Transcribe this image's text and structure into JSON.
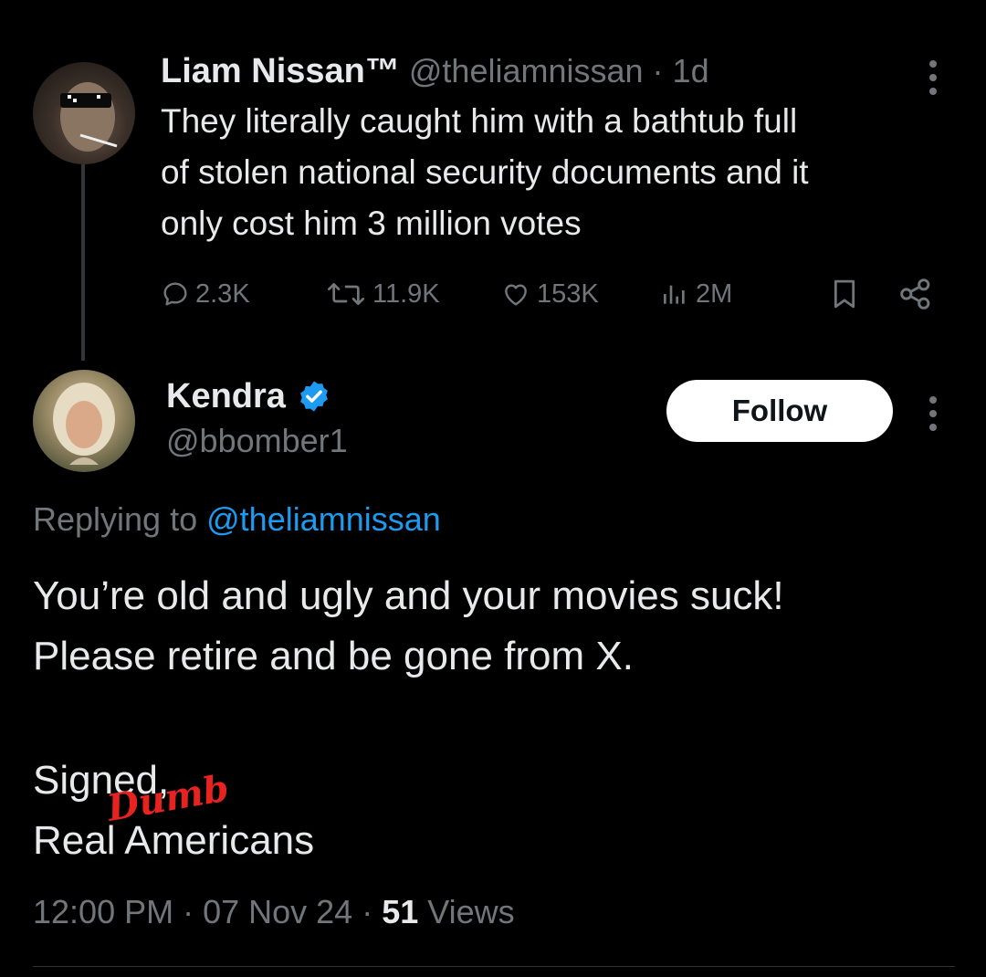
{
  "original_tweet": {
    "author_name": "Liam Nissan™",
    "handle": "@theliamnissan",
    "separator": "·",
    "time_ago": "1d",
    "text_lines": [
      "They literally caught him with a bathtub full",
      "of stolen national security documents and it",
      "only cost him 3 million votes"
    ],
    "actions": {
      "replies": "2.3K",
      "reposts": "11.9K",
      "likes": "153K",
      "views": "2M"
    }
  },
  "reply_tweet": {
    "author_name": "Kendra",
    "verified": true,
    "handle": "@bbomber1",
    "follow_label": "Follow",
    "replying_prefix": "Replying to",
    "replying_to": "@theliamnissan",
    "text_lines": [
      "You’re old and ugly and your movies suck!",
      "Please retire and be gone from X."
    ],
    "signed_line": "Signed,",
    "signoff_line": "Real Americans",
    "overlay_word": "Dumb",
    "time": "12:00 PM",
    "date": "07 Nov 24",
    "separator": "·",
    "views_count": "51",
    "views_label": "Views"
  },
  "colors": {
    "background": "#000000",
    "text_primary": "#e7e9ea",
    "text_secondary": "#71767b",
    "link": "#1d9bf0",
    "verified_badge": "#1d9bf0",
    "overlay_red": "#e8231f"
  }
}
